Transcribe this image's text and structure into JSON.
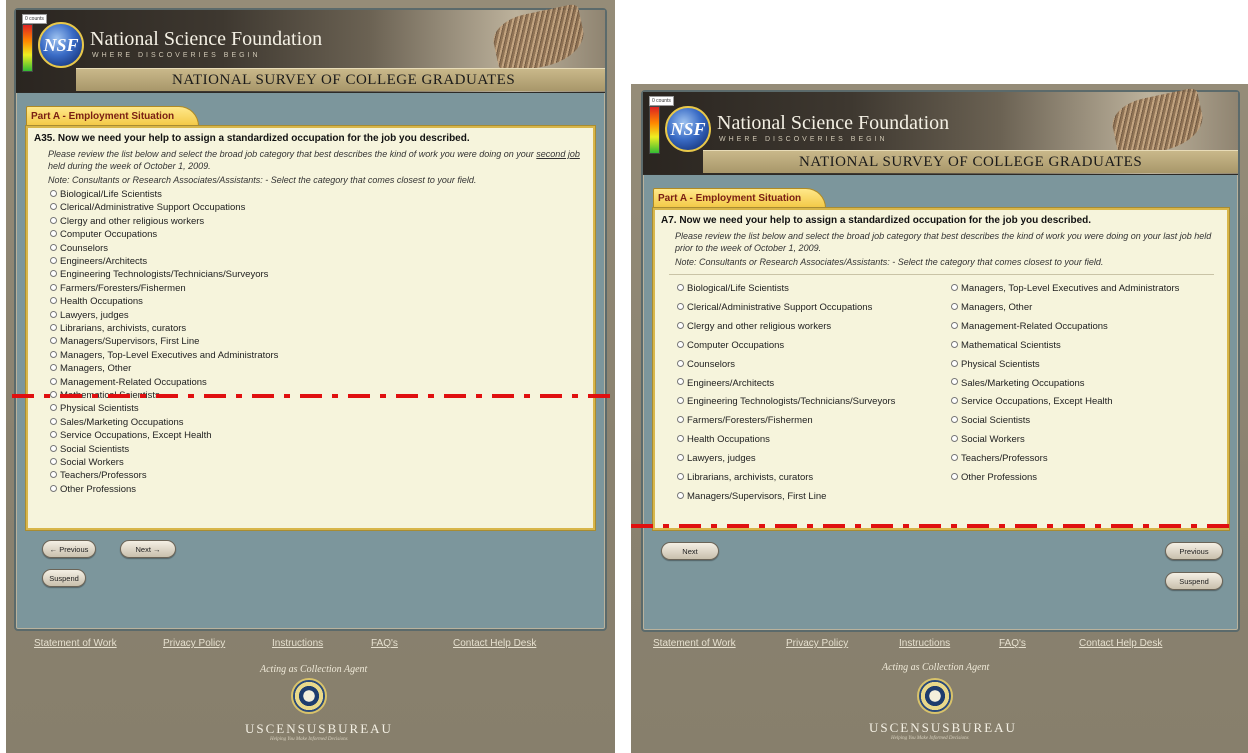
{
  "shared": {
    "counts": "0 counts",
    "org_name": "National Science Foundation",
    "tagline": "WHERE DISCOVERIES BEGIN",
    "nsf_logo_text": "NSF",
    "survey_title": "NATIONAL SURVEY OF COLLEGE GRADUATES",
    "part_tab": "Part A - Employment Situation",
    "note": "Note: Consultants or Research Associates/Assistants: - Select the category that comes closest to your field.",
    "footer_links": [
      "Statement of Work",
      "Privacy Policy",
      "Instructions",
      "FAQ's",
      "Contact Help Desk"
    ],
    "acting_as": "Acting as Collection Agent",
    "census_name": "USCENSUSBUREAU",
    "census_tagline": "Helping You Make Informed Decisions"
  },
  "left": {
    "question_title": "A35. Now we need your help to assign a standardized occupation for the job you described.",
    "instruction_1": "Please review the list below and select the broad job category that best describes the kind of work you were doing on your",
    "instruction_underlined": "second job",
    "instruction_2": " held during the week of October 1, 2009.",
    "options": [
      "Biological/Life Scientists",
      "Clerical/Administrative Support Occupations",
      "Clergy and other religious workers",
      "Computer Occupations",
      "Counselors",
      "Engineers/Architects",
      "Engineering Technologists/Technicians/Surveyors",
      "Farmers/Foresters/Fishermen",
      "Health Occupations",
      "Lawyers, judges",
      "Librarians, archivists, curators",
      "Managers/Supervisors, First Line",
      "Managers, Top-Level Executives and Administrators",
      "Managers, Other",
      "Management-Related Occupations",
      "Mathematical Scientists",
      "Physical Scientists",
      "Sales/Marketing Occupations",
      "Service Occupations, Except Health",
      "Social Scientists",
      "Social Workers",
      "Teachers/Professors",
      "Other Professions"
    ],
    "previous_label": "← Previous",
    "next_label": "Next →",
    "suspend_label": "Suspend"
  },
  "right": {
    "question_title": "A7. Now we need your help to assign a standardized occupation for the job you described.",
    "instruction": "Please review the list below and select the broad job category that best describes the kind of work you were doing on your last job held prior to the week of October 1, 2009.",
    "options_col1": [
      "Biological/Life Scientists",
      "Clerical/Administrative Support Occupations",
      "Clergy and other religious workers",
      "Computer Occupations",
      "Counselors",
      "Engineers/Architects",
      "Engineering Technologists/Technicians/Surveyors",
      "Farmers/Foresters/Fishermen",
      "Health Occupations",
      "Lawyers, judges",
      "Librarians, archivists, curators",
      "Managers/Supervisors, First Line"
    ],
    "options_col2": [
      "Managers, Top-Level Executives and Administrators",
      "Managers, Other",
      "Management-Related Occupations",
      "Mathematical Scientists",
      "Physical Scientists",
      "Sales/Marketing Occupations",
      "Service Occupations, Except Health",
      "Social Scientists",
      "Social Workers",
      "Teachers/Professors",
      "Other Professions"
    ],
    "next_label": "Next",
    "previous_label": "Previous",
    "suspend_label": "Suspend"
  },
  "colors": {
    "outer_bg": "#8d8571",
    "frame": "#7c969c",
    "content_bg": "#f6f4dc",
    "tab_gold": "#f3c845",
    "tab_text": "#7a1f14",
    "marker_red": "#e01010"
  }
}
